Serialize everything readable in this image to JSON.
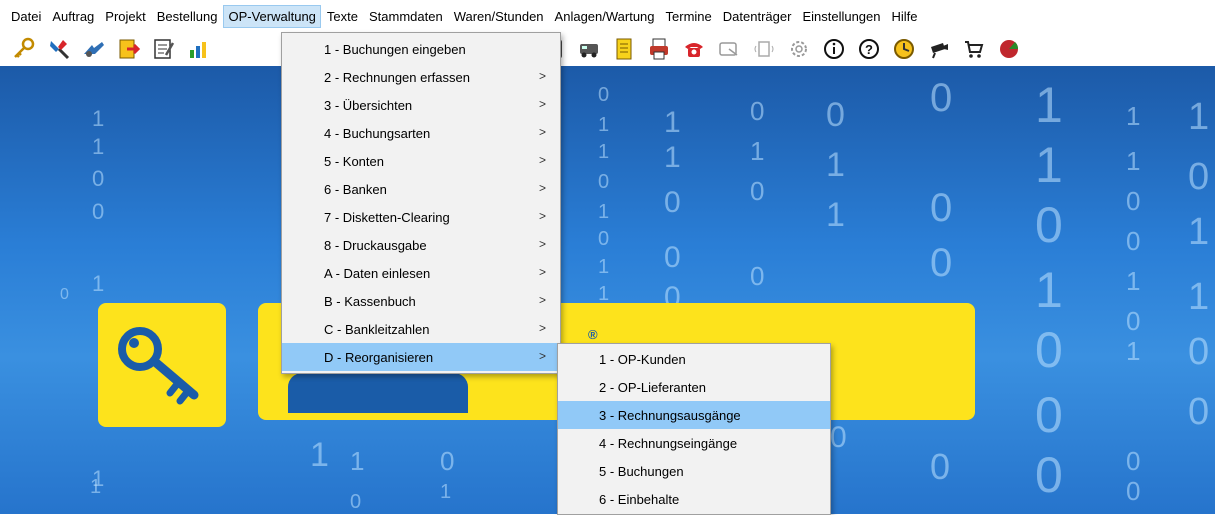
{
  "menubar": {
    "items": [
      {
        "label": "Datei"
      },
      {
        "label": "Auftrag"
      },
      {
        "label": "Projekt"
      },
      {
        "label": "Bestellung"
      },
      {
        "label": "OP-Verwaltung",
        "active": true
      },
      {
        "label": "Texte"
      },
      {
        "label": "Stammdaten"
      },
      {
        "label": "Waren/Stunden"
      },
      {
        "label": "Anlagen/Wartung"
      },
      {
        "label": "Termine"
      },
      {
        "label": "Datenträger"
      },
      {
        "label": "Einstellungen"
      },
      {
        "label": "Hilfe"
      }
    ]
  },
  "toolbar": {
    "left_icons": [
      "key-icon",
      "tools-icon",
      "binoculars-icon",
      "edit-arrow-icon",
      "notepad-icon",
      "bar-chart-icon"
    ],
    "right_icons": [
      "document-icon",
      "list-icon",
      "truck-icon",
      "yellow-notes-icon",
      "printer-icon",
      "telephone-icon",
      "scanner-icon",
      "fax-icon",
      "settings-icon",
      "info-icon",
      "help-icon",
      "clock-icon",
      "camera-icon",
      "cart-icon",
      "exit-icon"
    ]
  },
  "op_menu": {
    "items": [
      {
        "label": "1 - Buchungen eingeben",
        "submenu": false
      },
      {
        "label": "2 - Rechnungen erfassen",
        "submenu": true
      },
      {
        "label": "3 - Übersichten",
        "submenu": true
      },
      {
        "label": "4 - Buchungsarten",
        "submenu": true
      },
      {
        "label": "5 - Konten",
        "submenu": true
      },
      {
        "label": "6 - Banken",
        "submenu": true
      },
      {
        "label": "7 - Disketten-Clearing",
        "submenu": true
      },
      {
        "label": "8 - Druckausgabe",
        "submenu": true
      },
      {
        "label": "A - Daten einlesen",
        "submenu": true
      },
      {
        "label": "B - Kassenbuch",
        "submenu": true
      },
      {
        "label": "C - Bankleitzahlen",
        "submenu": true
      },
      {
        "label": "D - Reorganisieren",
        "submenu": true,
        "highlighted": true
      }
    ],
    "arrow": ">"
  },
  "reorg_submenu": {
    "items": [
      {
        "label": "1 - OP-Kunden"
      },
      {
        "label": "2 - OP-Lieferanten"
      },
      {
        "label": "3 - Rechnungsausgänge",
        "highlighted": true
      },
      {
        "label": "4 - Rechnungseingänge"
      },
      {
        "label": "5 - Buchungen"
      },
      {
        "label": "6 - Einbehalte"
      }
    ]
  },
  "background": {
    "logo_partial": "®",
    "digits": [
      "1",
      "1",
      "0",
      "0",
      "1",
      "1",
      "0",
      "1",
      "1",
      "0",
      "1",
      "0",
      "1",
      "1",
      "1",
      "1",
      "0",
      "0",
      "0",
      "0",
      "1",
      "0",
      "0",
      "0",
      "1",
      "1",
      "0",
      "0",
      "0",
      "1",
      "1",
      "0",
      "1",
      "0",
      "0",
      "0",
      "1",
      "1",
      "0",
      "0",
      "1",
      "0",
      "0",
      "0",
      "1",
      "0",
      "1",
      "1",
      "0",
      "0",
      "1",
      "1",
      "0",
      "0",
      "1",
      "1",
      "0",
      "1",
      "0",
      "0"
    ]
  },
  "colors": {
    "menu_active_bg": "#cce4f7",
    "menu_highlight": "#91c9f7",
    "desktop_blue": "#2a7ed6",
    "logo_yellow": "#fde31c"
  }
}
